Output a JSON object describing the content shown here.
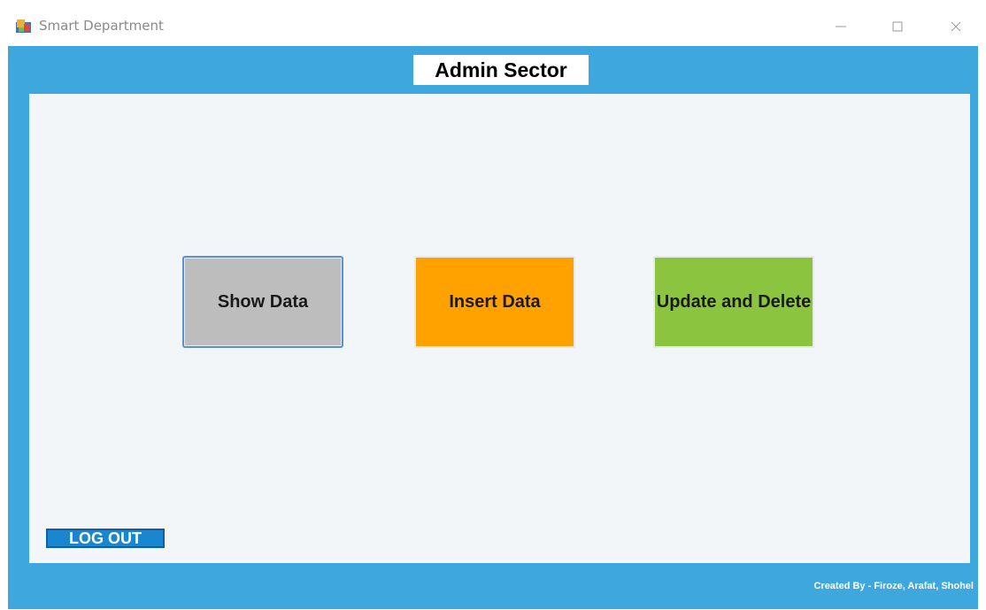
{
  "window": {
    "title": "Smart Department",
    "icon": "app-window-icon",
    "controls": [
      "minimize-icon",
      "maximize-icon",
      "close-icon"
    ]
  },
  "header": {
    "title": "Admin Sector"
  },
  "actions": {
    "show_data": "Show Data",
    "insert_data": "Insert Data",
    "update_delete": "Update and Delete"
  },
  "logout": {
    "label": "LOG OUT"
  },
  "footer": {
    "credit": "Created By - Firoze, Arafat, Shohel"
  },
  "colors": {
    "frame": "#3ea7dd",
    "show_data_bg": "#bdbdbd",
    "insert_data_bg": "#ffa200",
    "update_delete_bg": "#8bc53f",
    "logout_bg": "#1a86d0"
  }
}
